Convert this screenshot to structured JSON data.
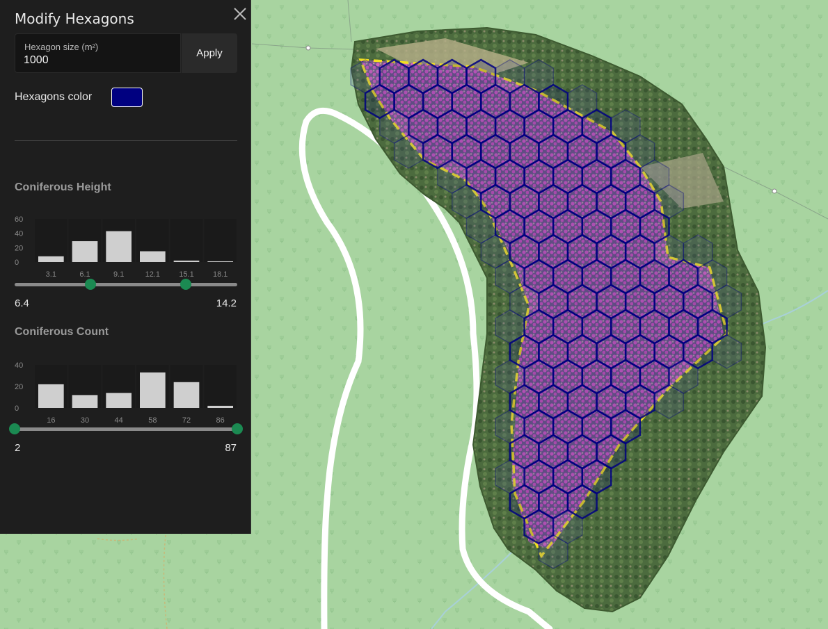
{
  "panel": {
    "title": "Modify Hexagons",
    "close_icon": "close-icon",
    "hexagon_size": {
      "label": "Hexagon size (m²)",
      "value": "1000"
    },
    "apply_label": "Apply",
    "color": {
      "label": "Hexagons color",
      "value": "#000080"
    }
  },
  "histograms": [
    {
      "title": "Coniferous Height",
      "y_ticks": [
        "60",
        "40",
        "20",
        "0"
      ],
      "ymax": 60,
      "categories": [
        "3.1",
        "6.1",
        "9.1",
        "12.1",
        "15.1",
        "18.1"
      ],
      "values": [
        8,
        29,
        43,
        15,
        2,
        1
      ],
      "range": {
        "min_label": "6.4",
        "max_label": "14.2",
        "low": 0.34,
        "high": 0.77
      }
    },
    {
      "title": "Coniferous Count",
      "y_ticks": [
        "40",
        "20",
        "0"
      ],
      "ymax": 40,
      "categories": [
        "16",
        "30",
        "44",
        "58",
        "72",
        "86"
      ],
      "values": [
        22,
        12,
        14,
        33,
        24,
        2
      ],
      "range": {
        "min_label": "2",
        "max_label": "87",
        "low": 0.0,
        "high": 1.0
      }
    }
  ],
  "chart_data": [
    {
      "type": "bar",
      "title": "Coniferous Height",
      "categories": [
        "3.1",
        "6.1",
        "9.1",
        "12.1",
        "15.1",
        "18.1"
      ],
      "values": [
        8,
        29,
        43,
        15,
        2,
        1
      ],
      "ylim": [
        0,
        60
      ]
    },
    {
      "type": "bar",
      "title": "Coniferous Count",
      "categories": [
        "16",
        "30",
        "44",
        "58",
        "72",
        "86"
      ],
      "values": [
        22,
        12,
        14,
        33,
        24,
        2
      ],
      "ylim": [
        0,
        40
      ]
    }
  ],
  "map": {
    "hexagon_color": "#000080",
    "boundary_color": "#f2e020",
    "tree_color": "#e060c8",
    "background_color": "#a8d4a0"
  }
}
